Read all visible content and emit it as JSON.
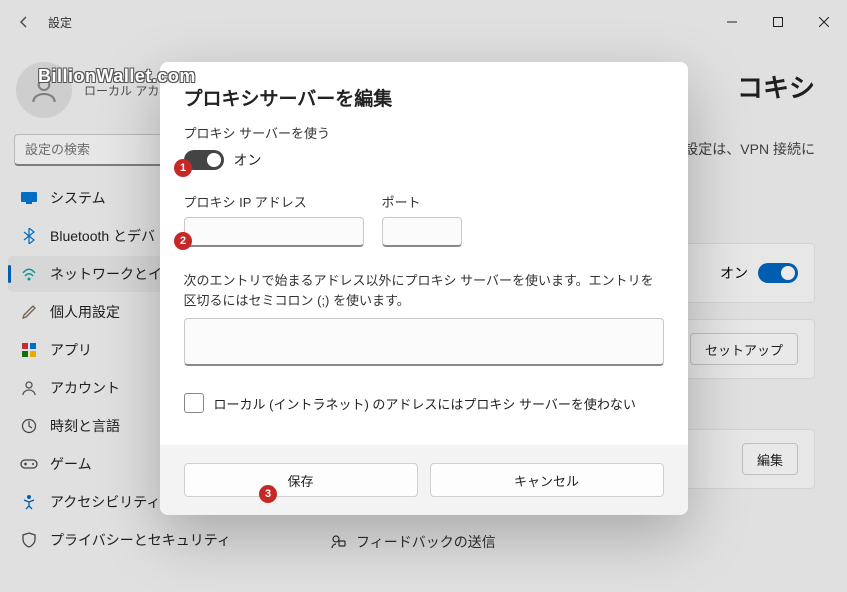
{
  "titlebar": {
    "app_title": "設定"
  },
  "user": {
    "name": "",
    "type": "ローカル アカウ"
  },
  "search": {
    "placeholder": "設定の検索"
  },
  "nav": {
    "items": [
      {
        "label": "システム"
      },
      {
        "label": "Bluetooth とデバ"
      },
      {
        "label": "ネットワークとイン"
      },
      {
        "label": "個人用設定"
      },
      {
        "label": "アプリ"
      },
      {
        "label": "アカウント"
      },
      {
        "label": "時刻と言語"
      },
      {
        "label": "ゲーム"
      },
      {
        "label": "アクセシビリティ"
      },
      {
        "label": "プライバシーとセキュリティ"
      }
    ]
  },
  "page": {
    "title_fragment": "コキシ",
    "desc_fragment": "の設定は、VPN 接続に"
  },
  "cards": {
    "toggle_label": "オン",
    "setup_label": "セットアップ",
    "edit_label": "編集"
  },
  "feedback": {
    "label": "フィードバックの送信"
  },
  "dialog": {
    "title": "プロキシサーバーを編集",
    "use_proxy_label": "プロキシ サーバーを使う",
    "toggle_state": "オン",
    "ip_label": "プロキシ IP アドレス",
    "port_label": "ポート",
    "ip_value": "",
    "port_value": "",
    "bypass_desc": "次のエントリで始まるアドレス以外にプロキシ サーバーを使います。エントリを区切るにはセミコロン (;) を使います。",
    "bypass_value": "",
    "local_check_label": "ローカル (イントラネット) のアドレスにはプロキシ サーバーを使わない",
    "save_label": "保存",
    "cancel_label": "キャンセル"
  },
  "badges": {
    "b1": "1",
    "b2": "2",
    "b3": "3"
  },
  "watermark": "BillionWallet.com"
}
